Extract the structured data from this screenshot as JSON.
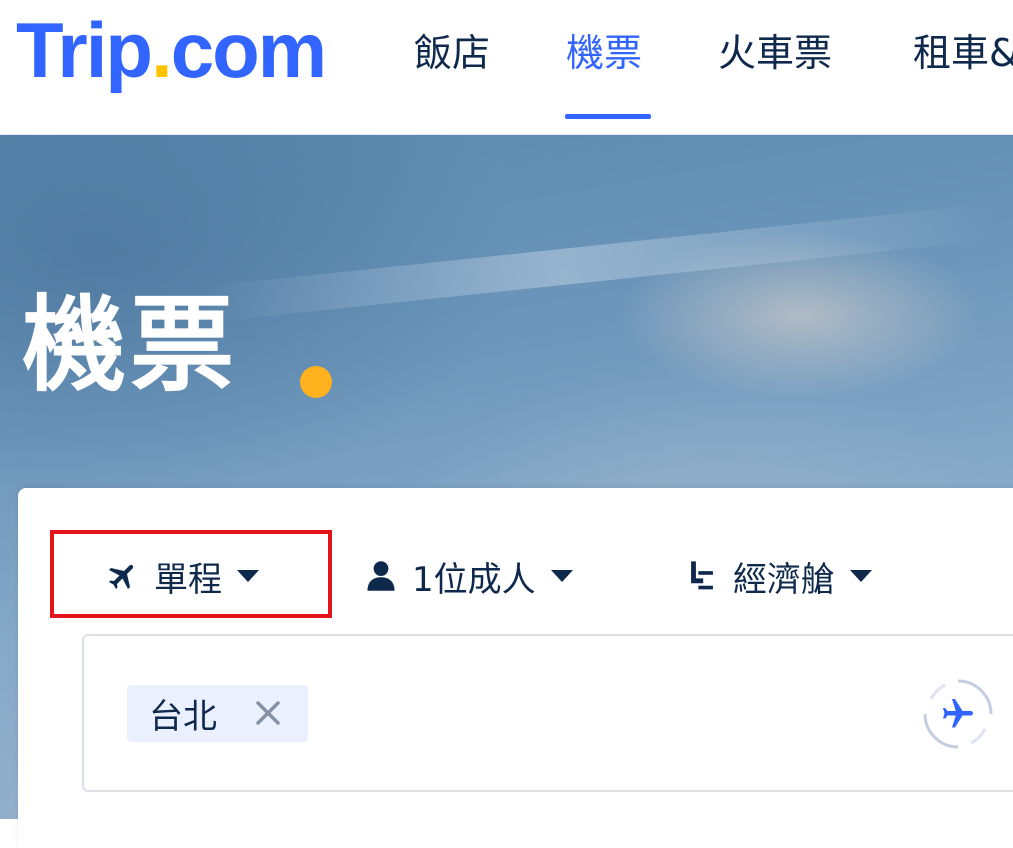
{
  "header": {
    "logo": {
      "text": "Trip",
      "dot": ".",
      "suffix": "com"
    },
    "nav": [
      {
        "label": "飯店",
        "active": false
      },
      {
        "label": "機票",
        "active": true
      },
      {
        "label": "火車票",
        "active": false
      },
      {
        "label": "租車&",
        "active": false
      }
    ]
  },
  "hero": {
    "title": "機票"
  },
  "search": {
    "trip_type": {
      "label": "單程",
      "icon": "plane-icon"
    },
    "passengers": {
      "label": "1位成人",
      "icon": "person-icon"
    },
    "cabin": {
      "label": "經濟艙",
      "icon": "seat-icon"
    },
    "origin_chip": {
      "label": "台北"
    }
  },
  "colors": {
    "brand": "#3264ff",
    "accent_dot": "#ffc300",
    "text": "#0f294d",
    "highlight": "#e3141a",
    "chip_bg": "#ebf0ff"
  }
}
